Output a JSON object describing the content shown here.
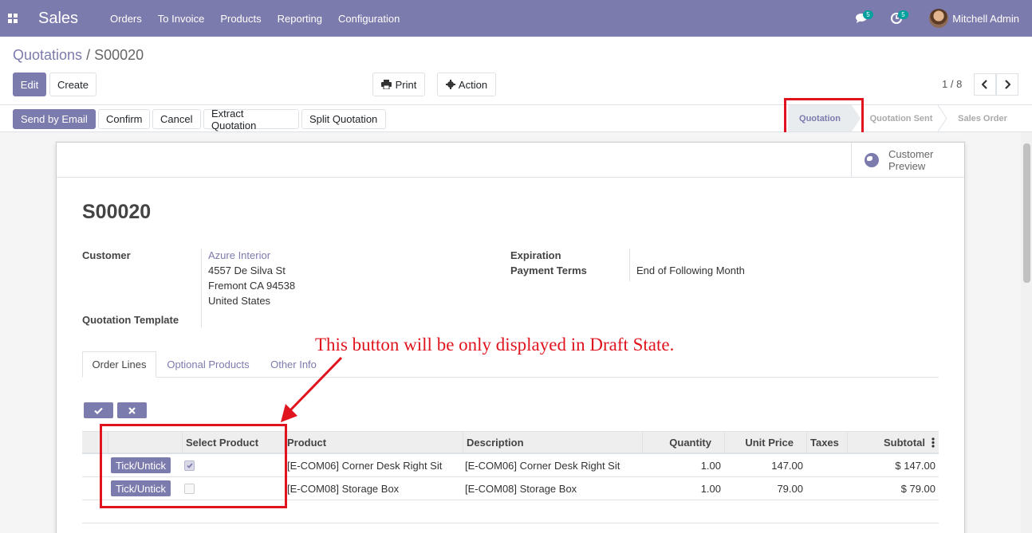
{
  "navbar": {
    "app_name": "Sales",
    "menu": [
      "Orders",
      "To Invoice",
      "Products",
      "Reporting",
      "Configuration"
    ],
    "messages_count": "5",
    "activities_count": "5",
    "user_name": "Mitchell Admin"
  },
  "breadcrumb": {
    "parent": "Quotations",
    "separator": "/",
    "current": "S00020"
  },
  "toolbar": {
    "edit": "Edit",
    "create": "Create",
    "print": "Print",
    "action": "Action"
  },
  "pager": {
    "value": "1 / 8"
  },
  "statusbar": {
    "buttons": [
      "Send by Email",
      "Confirm",
      "Cancel",
      "Extract Quotation",
      "Split Quotation"
    ],
    "stages": [
      "Quotation",
      "Quotation Sent",
      "Sales Order"
    ],
    "active_stage": "Quotation"
  },
  "sheet": {
    "customer_preview": [
      "Customer",
      "Preview"
    ],
    "name": "S00020",
    "customer_label": "Customer",
    "customer_name": "Azure Interior",
    "address": [
      "4557 De Silva St",
      "Fremont CA 94538",
      "United States"
    ],
    "quotation_template_label": "Quotation Template",
    "expiration_label": "Expiration",
    "payment_terms_label": "Payment Terms",
    "payment_terms_value": "End of Following Month"
  },
  "annotation": "This button will be only displayed in Draft State.",
  "tabs": [
    "Order Lines",
    "Optional Products",
    "Other Info"
  ],
  "table": {
    "headers": [
      "Select Product",
      "Product",
      "Description",
      "Quantity",
      "Unit Price",
      "Taxes",
      "Subtotal"
    ],
    "tick_label": "Tick/Untick",
    "rows": [
      {
        "selected": true,
        "product": "[E-COM06] Corner Desk Right Sit",
        "description": "[E-COM06] Corner Desk Right Sit",
        "quantity": "1.00",
        "unit_price": "147.00",
        "taxes": "",
        "subtotal": "$ 147.00"
      },
      {
        "selected": false,
        "product": "[E-COM08] Storage Box",
        "description": "[E-COM08] Storage Box",
        "quantity": "1.00",
        "unit_price": "79.00",
        "taxes": "",
        "subtotal": "$ 79.00"
      }
    ]
  },
  "colors": {
    "brand": "#7c7bad",
    "annotation_red": "#e0141e"
  }
}
